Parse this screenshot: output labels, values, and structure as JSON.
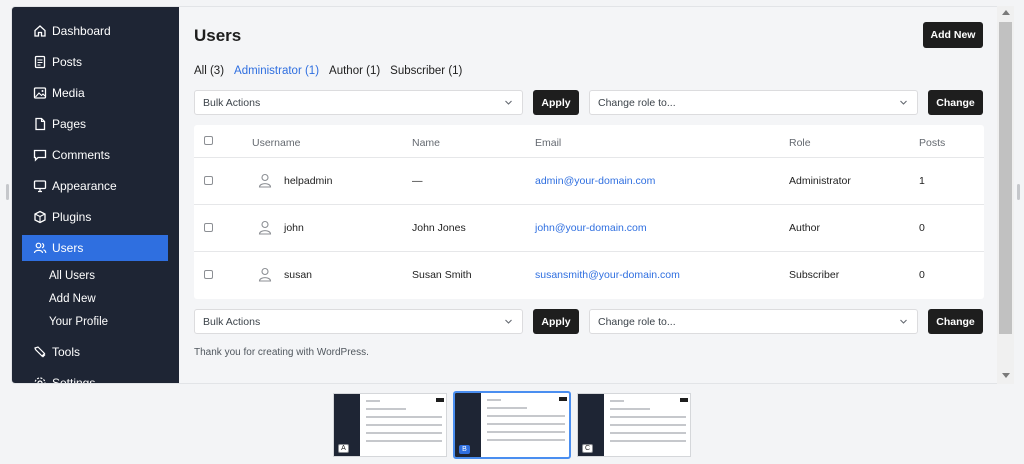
{
  "sidebar": {
    "items": [
      {
        "label": "Dashboard",
        "icon": "home-icon"
      },
      {
        "label": "Posts",
        "icon": "posts-icon"
      },
      {
        "label": "Media",
        "icon": "media-icon"
      },
      {
        "label": "Pages",
        "icon": "pages-icon"
      },
      {
        "label": "Comments",
        "icon": "comments-icon"
      },
      {
        "label": "Appearance",
        "icon": "appearance-icon"
      },
      {
        "label": "Plugins",
        "icon": "plugins-icon"
      },
      {
        "label": "Users",
        "icon": "users-icon",
        "active": true
      }
    ],
    "sub_items": [
      "All Users",
      "Add New",
      "Your Profile"
    ],
    "after_items": [
      {
        "label": "Tools",
        "icon": "tools-icon"
      },
      {
        "label": "Settings",
        "icon": "settings-icon"
      }
    ]
  },
  "header": {
    "title": "Users",
    "add_new_label": "Add New"
  },
  "filters": [
    {
      "label": "All (3)",
      "current": false
    },
    {
      "label": "Administrator (1)",
      "current": true
    },
    {
      "label": "Author (1)",
      "current": false
    },
    {
      "label": "Subscriber (1)",
      "current": false
    }
  ],
  "bulk_top": {
    "bulk_select": "Bulk Actions",
    "apply_label": "Apply",
    "role_select": "Change role to...",
    "change_label": "Change"
  },
  "bulk_bottom": {
    "bulk_select": "Bulk Actions",
    "apply_label": "Apply",
    "role_select": "Change role to...",
    "change_label": "Change"
  },
  "table": {
    "columns": [
      "Username",
      "Name",
      "Email",
      "Role",
      "Posts"
    ],
    "rows": [
      {
        "username": "helpadmin",
        "name": "—",
        "email": "admin@your-domain.com",
        "role": "Administrator",
        "posts": "1"
      },
      {
        "username": "john",
        "name": "John Jones",
        "email": "john@your-domain.com",
        "role": "Author",
        "posts": "0"
      },
      {
        "username": "susan",
        "name": "Susan Smith",
        "email": "susansmith@your-domain.com",
        "role": "Subscriber",
        "posts": "0"
      }
    ]
  },
  "footer": {
    "note": "Thank you for creating with WordPress."
  },
  "thumbnails": [
    "A",
    "B",
    "C"
  ],
  "colors": {
    "accent": "#2f6fe0",
    "sidebar_bg": "#1e2534",
    "button_dark": "#1e1e1e"
  }
}
